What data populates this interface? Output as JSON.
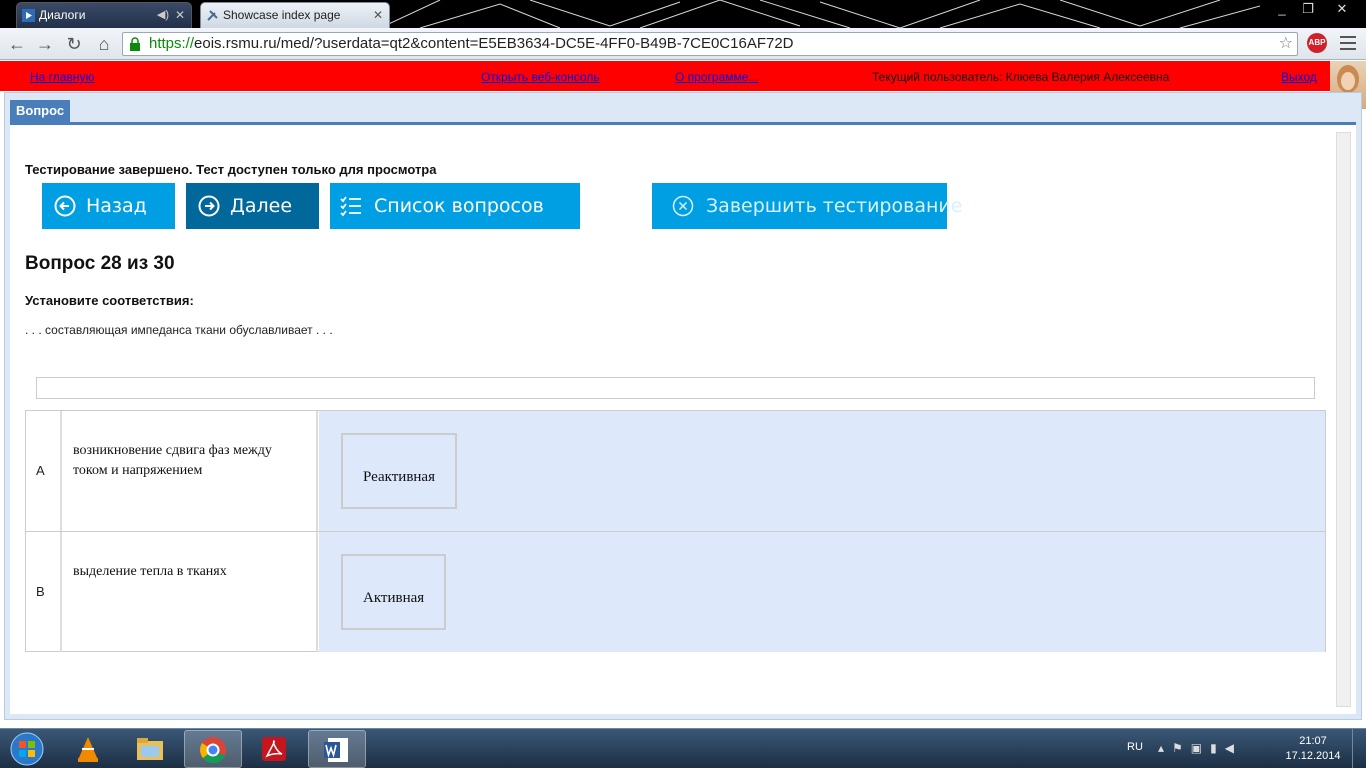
{
  "browser": {
    "tabs": [
      {
        "label": "Диалоги",
        "active": false
      },
      {
        "label": "Showcase index page",
        "active": true
      }
    ],
    "url_https": "https://",
    "url_rest": "eois.rsmu.ru/med/?userdata=qt2&content=E5EB3634-DC5E-4FF0-B49B-7CE0C16AF72D",
    "abp_label": "ABP"
  },
  "topbar": {
    "home": "На главную",
    "console": "Открыть веб-консоль",
    "about": "О программе...",
    "user_label": "Текущий пользователь: Клюева Валерия Алексеевна",
    "logout": "Выход"
  },
  "panel": {
    "tab_label": "Вопрос"
  },
  "test": {
    "status": "Тестирование завершено. Тест доступен только для просмотра",
    "buttons": {
      "back": "Назад",
      "next": "Далее",
      "list": "Список вопросов",
      "finish": "Завершить тестирование"
    },
    "heading": "Вопрос 28 из 30",
    "instruction": "Установите соответствия:",
    "question_text": ". . . составляющая импеданса ткани обуславливает . . .",
    "rows": [
      {
        "letter": "A",
        "statement": "возникновение сдвига фаз между током и напряжением",
        "answer": "Реактивная"
      },
      {
        "letter": "B",
        "statement": "выделение тепла в тканях",
        "answer": "Активная"
      }
    ]
  },
  "taskbar": {
    "lang": "RU",
    "time": "21:07",
    "date": "17.12.2014"
  },
  "colors": {
    "accent_blue": "#009fe3",
    "dark_blue": "#00689a",
    "topbar_red": "#ff0000",
    "drop_zone": "#dde9fb"
  }
}
